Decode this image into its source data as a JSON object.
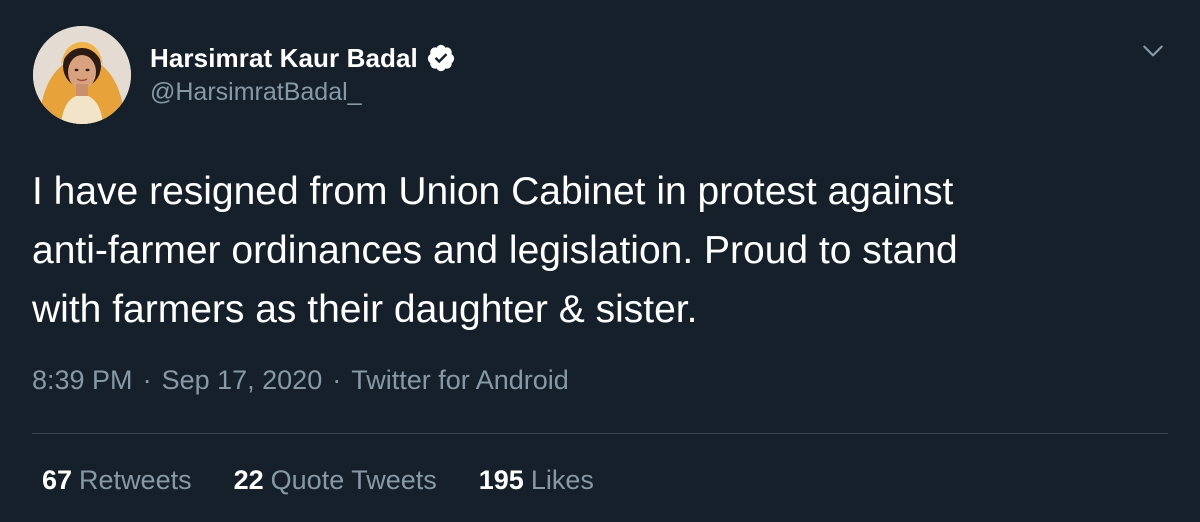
{
  "author": {
    "display_name": "Harsimrat Kaur Badal",
    "handle": "@HarsimratBadal_",
    "verified": true
  },
  "tweet": {
    "text_lines": [
      "I have resigned from Union Cabinet in protest against",
      "anti-farmer ordinances and legislation. Proud to stand",
      "with farmers as their daughter & sister."
    ],
    "time": "8:39 PM",
    "date": "Sep 17, 2020",
    "source": "Twitter for Android",
    "separator": "·"
  },
  "stats": {
    "retweets": {
      "count": "67",
      "label": "Retweets"
    },
    "quote_tweets": {
      "count": "22",
      "label": "Quote Tweets"
    },
    "likes": {
      "count": "195",
      "label": "Likes"
    }
  },
  "icons": {
    "verified": "verified-badge-icon",
    "menu": "chevron-down-icon"
  },
  "colors": {
    "background": "#15202b",
    "text_primary": "#ffffff",
    "text_secondary": "#8899a6",
    "divider": "#38444d"
  }
}
